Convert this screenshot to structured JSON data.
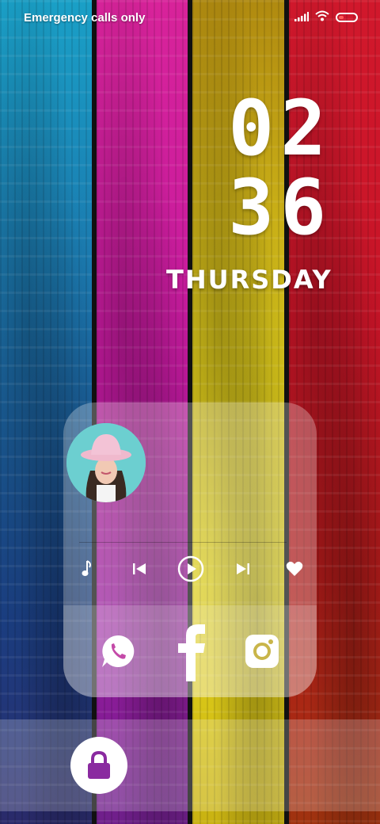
{
  "status_bar": {
    "carrier_text": "Emergency calls only",
    "icons": [
      "signal-icon",
      "wifi-icon",
      "battery-icon"
    ],
    "battery_color": "#ff5c5c"
  },
  "clock": {
    "hours": "02",
    "minutes": "36",
    "day": "Thursday"
  },
  "music_widget": {
    "avatar": "woman-in-pink-hat-avatar",
    "controls": [
      "music-note-icon",
      "previous-icon",
      "play-icon",
      "next-icon",
      "heart-icon"
    ]
  },
  "apps": [
    {
      "name": "whatsapp-icon"
    },
    {
      "name": "facebook-icon"
    },
    {
      "name": "instagram-icon"
    }
  ],
  "lock": {
    "icon": "lock-icon"
  },
  "colors": {
    "plank_blue": "#1b6fa8",
    "plank_magenta": "#c4199f",
    "plank_yellow": "#d6c21a",
    "plank_red": "#c71427"
  }
}
